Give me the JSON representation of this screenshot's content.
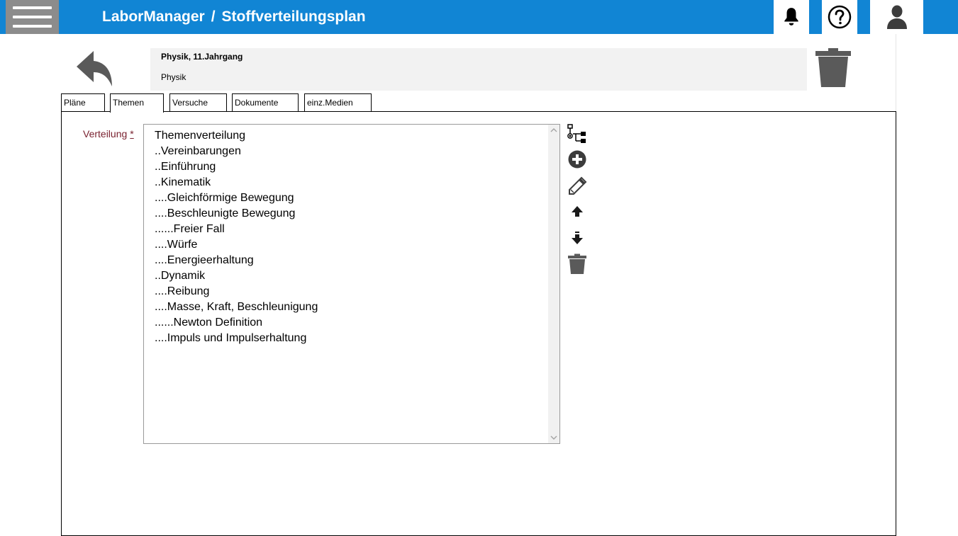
{
  "header": {
    "app_name": "LaborManager",
    "separator": "/",
    "page_title": "Stoffverteilungsplan"
  },
  "colors": {
    "topbar": "#1185d4",
    "icon_gray": "#5a5a5a",
    "label": "#7a2230"
  },
  "record": {
    "title": "Physik, 11.Jahrgang",
    "subject": "Physik"
  },
  "tabs": [
    {
      "label": "Pläne",
      "active": false
    },
    {
      "label": "Themen",
      "active": true
    },
    {
      "label": "Versuche",
      "active": false
    },
    {
      "label": "Dokumente",
      "active": false
    },
    {
      "label": "einz.Medien",
      "active": false
    }
  ],
  "form": {
    "label": "Verteilung",
    "required_marker": "*",
    "items": [
      "Themenverteilung",
      "..Vereinbarungen",
      "..Einführung",
      "..Kinematik",
      "....Gleichförmige Bewegung",
      "....Beschleunigte Bewegung",
      "......Freier Fall",
      "....Würfe",
      "....Energieerhaltung",
      "..Dynamik",
      "....Reibung",
      "....Masse, Kraft, Beschleunigung",
      "......Newton Definition",
      "....Impuls und Impulserhaltung"
    ]
  },
  "icons": {
    "menu": "hamburger-icon",
    "bell": "bell-icon",
    "help": "help-icon",
    "user": "user-icon",
    "back": "back-arrow-icon",
    "delete": "trash-icon",
    "tree": "tree-add-icon",
    "add": "plus-circle-icon",
    "edit": "pencil-icon",
    "up": "arrow-up-icon",
    "down": "arrow-down-icon"
  }
}
